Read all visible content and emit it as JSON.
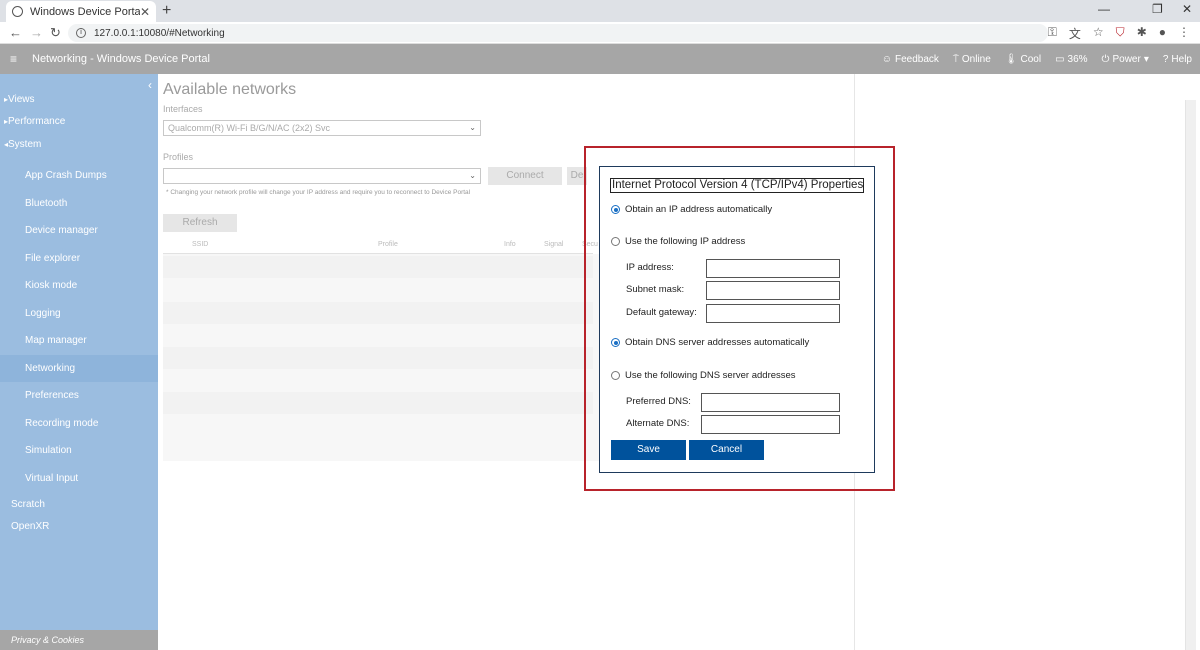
{
  "browser": {
    "tab_title": "Windows Device Portal",
    "tab_close": "✕",
    "new_tab": "+",
    "url": "127.0.0.1:10080/#Networking",
    "minimize": "—",
    "restore": "❐",
    "close": "✕"
  },
  "header": {
    "title": "Networking - Windows Device Portal",
    "feedback": "Feedback",
    "online": "Online",
    "cool": "Cool",
    "battery": "36%",
    "power": "Power",
    "help": "Help"
  },
  "sidebar": {
    "top": [
      {
        "label": "Views",
        "prefix": "▸"
      },
      {
        "label": "Performance",
        "prefix": "▸"
      },
      {
        "label": "System",
        "prefix": "◂"
      }
    ],
    "system_items": [
      "App Crash Dumps",
      "Bluetooth",
      "Device manager",
      "File explorer",
      "Kiosk mode",
      "Logging",
      "Map manager",
      "Networking",
      "Preferences",
      "Recording mode",
      "Simulation",
      "Virtual Input"
    ],
    "bottom": [
      "Scratch",
      "OpenXR"
    ],
    "privacy": "Privacy & Cookies"
  },
  "main": {
    "title": "Available networks",
    "interfaces_label": "Interfaces",
    "interface_value": "Qualcomm(R) Wi-Fi B/G/N/AC (2x2) Svc",
    "profiles_label": "Profiles",
    "profile_value": "",
    "connect": "Connect",
    "disconnect_partial": "De",
    "hint": "* Changing your network profile will change your IP address and require you to reconnect to Device Portal",
    "refresh": "Refresh",
    "columns": [
      "SSID",
      "Profile",
      "Info",
      "Signal",
      "Secu"
    ]
  },
  "dialog": {
    "title": "Internet Protocol Version 4 (TCP/IPv4) Properties",
    "ip_auto": "Obtain an IP address automatically",
    "ip_manual": "Use the following IP address",
    "ip_address": "IP address:",
    "subnet_mask": "Subnet mask:",
    "default_gateway": "Default gateway:",
    "dns_auto": "Obtain DNS server addresses automatically",
    "dns_manual": "Use the following DNS server addresses",
    "preferred_dns": "Preferred DNS:",
    "alternate_dns": "Alternate DNS:",
    "save": "Save",
    "cancel": "Cancel"
  }
}
